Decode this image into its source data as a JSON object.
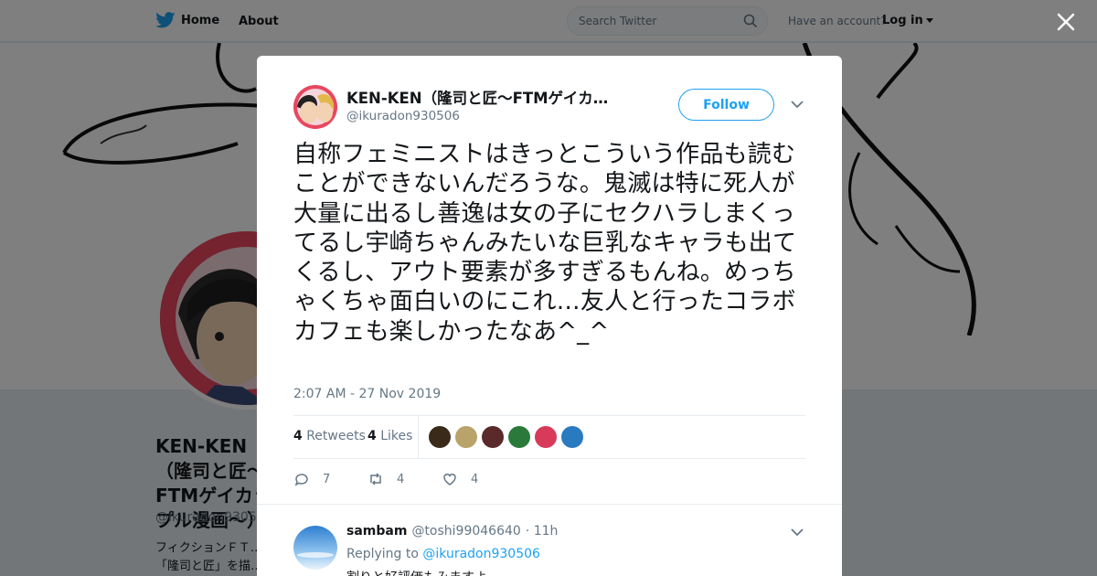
{
  "topbar": {
    "home_label": "Home",
    "about_label": "About",
    "search_placeholder": "Search Twitter",
    "have_account": "Have an account?",
    "login_label": "Log in"
  },
  "profile": {
    "name": "KEN-KEN（隆司と匠〜FTMゲイカップル漫画〜）",
    "handle": "@ikuradon930506",
    "bio": "フィクションＦＴ…「隆司と匠」を描…"
  },
  "tweet": {
    "author_name": "KEN-KEN（隆司と匠〜FTMゲイカ…",
    "author_handle": "@ikuradon930506",
    "follow_label": "Follow",
    "text": "自称フェミニストはきっとこういう作品も読むことができないんだろうな。鬼滅は特に死人が大量に出るし善逸は女の子にセクハラしまくってるし宇崎ちゃんみたいな巨乳なキャラも出てくるし、アウト要素が多すぎるもんね。めっちゃくちゃ面白いのにこれ…友人と行ったコラボカフェも楽しかったなあ^_^",
    "timestamp": "2:07 AM - 27 Nov 2019",
    "retweets_count": "4",
    "retweets_label": "Retweets",
    "likes_count": "4",
    "likes_label": "Likes",
    "reply_count": "7",
    "retweet_action_count": "4",
    "like_action_count": "4",
    "likers": [
      "#3a2a1a",
      "#b9a36a",
      "#5a2a2a",
      "#2b7a3b",
      "#d83a5a",
      "#2a7abf"
    ]
  },
  "reply": {
    "name": "sambam",
    "handle": "@toshi99046640",
    "time": "· 11h",
    "replying_prefix": "Replying to",
    "replying_to": "@ikuradon930506",
    "text": "割りと好評価もみますよ"
  },
  "colors": {
    "accent": "#1da1f2",
    "text": "#14171a",
    "muted": "#657786"
  }
}
